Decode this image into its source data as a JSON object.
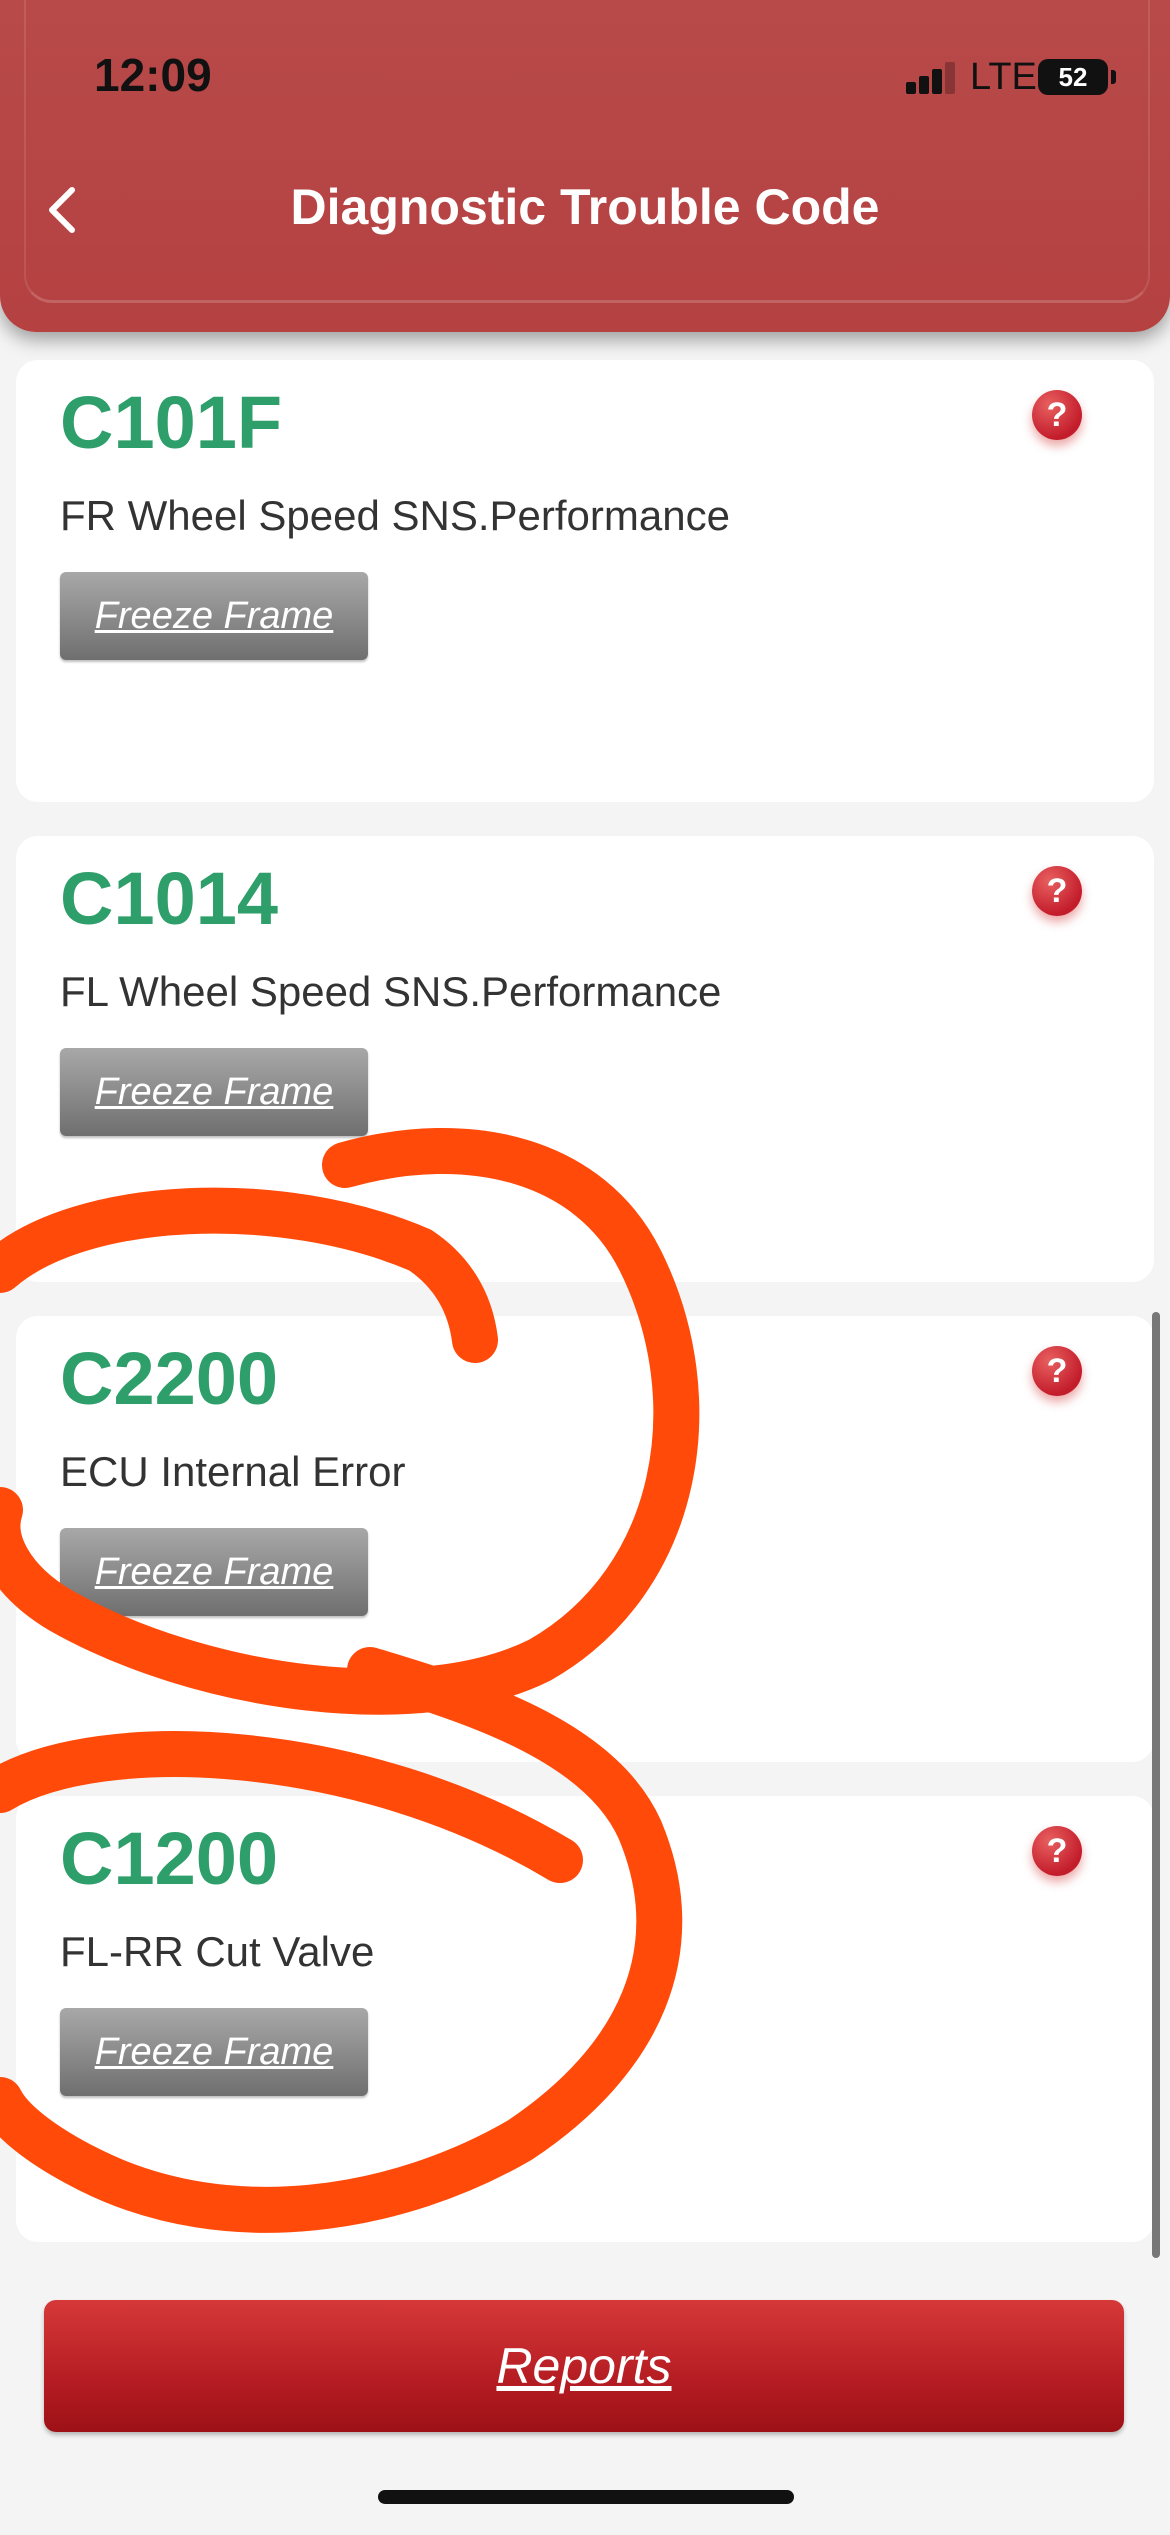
{
  "status_bar": {
    "time": "12:09",
    "network": "LTE",
    "battery": "52"
  },
  "header": {
    "title": "Diagnostic Trouble Code"
  },
  "dtc_list": [
    {
      "code": "C101F",
      "description": "FR Wheel Speed SNS.Performance",
      "button_label": "Freeze Frame"
    },
    {
      "code": "C1014",
      "description": "FL Wheel Speed SNS.Performance",
      "button_label": "Freeze Frame"
    },
    {
      "code": "C2200",
      "description": "ECU Internal Error",
      "button_label": "Freeze Frame"
    },
    {
      "code": "C1200",
      "description": "FL-RR Cut Valve",
      "button_label": "Freeze Frame"
    }
  ],
  "help_icon_symbol": "?",
  "footer": {
    "reports_label": "Reports"
  },
  "colors": {
    "header": "#b54141",
    "code_green": "#2e9e6a",
    "help_red": "#c31d2b",
    "annotation_orange": "#ff4a0a"
  }
}
